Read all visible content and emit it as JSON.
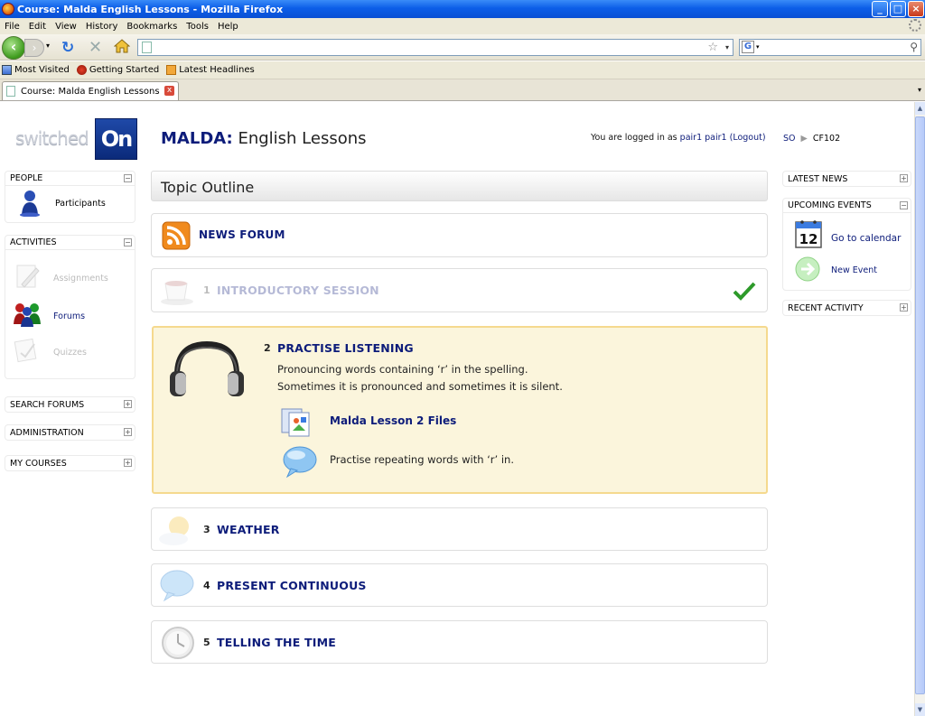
{
  "window": {
    "title": "Course: Malda English Lessons - Mozilla Firefox",
    "buttons": [
      "_",
      "□",
      "×"
    ]
  },
  "menu": [
    "File",
    "Edit",
    "View",
    "History",
    "Bookmarks",
    "Tools",
    "Help"
  ],
  "navbar": {
    "url": "",
    "search_value": ""
  },
  "bookmarks": [
    {
      "label": "Most Visited",
      "icon": "bookmark-folder-icon"
    },
    {
      "label": "Getting Started",
      "icon": "firefox-red-icon"
    },
    {
      "label": "Latest Headlines",
      "icon": "rss-feed-icon"
    }
  ],
  "tab": {
    "label": "Course: Malda English Lessons"
  },
  "header": {
    "logo_word": "switched",
    "logo_on": "On",
    "course_short": "MALDA:",
    "course_full": "English Lessons",
    "login_prefix": "You are logged in as",
    "user_name": "pair1 pair1",
    "logout": "(Logout)",
    "breadcrumb": [
      "SO",
      "CF102"
    ]
  },
  "left_blocks": {
    "people": {
      "title": "PEOPLE",
      "items": [
        {
          "label": "Participants",
          "icon": "person-icon"
        }
      ]
    },
    "activities": {
      "title": "ACTIVITIES",
      "items": [
        {
          "label": "Assignments",
          "icon": "pencil-icon"
        },
        {
          "label": "Forums",
          "icon": "group-icon"
        },
        {
          "label": "Quizzes",
          "icon": "quiz-icon"
        }
      ]
    },
    "search_forums": {
      "title": "SEARCH FORUMS"
    },
    "administration": {
      "title": "ADMINISTRATION"
    },
    "my_courses": {
      "title": "MY COURSES"
    }
  },
  "right_blocks": {
    "latest_news": {
      "title": "LATEST NEWS"
    },
    "upcoming_events": {
      "title": "UPCOMING EVENTS",
      "calendar_link": "Go to calendar",
      "calendar_day": "12",
      "new_event": "New Event"
    },
    "recent_activity": {
      "title": "RECENT ACTIVITY"
    }
  },
  "main": {
    "outline_title": "Topic Outline",
    "news_forum": "NEWS FORUM",
    "topics": [
      {
        "num": "1",
        "title": "INTRODUCTORY SESSION",
        "icon": "teacup-icon",
        "completed": true,
        "hidden": true
      },
      {
        "num": "2",
        "title": "PRACTISE LISTENING",
        "icon": "headphones-icon",
        "summary_line1": "Pronouncing words containing ‘r’ in the spelling.",
        "summary_line2": "Sometimes it is pronounced and sometimes it is silent.",
        "resources": [
          {
            "label": "Malda Lesson 2 Files",
            "icon": "files-icon",
            "link": true
          },
          {
            "label": "Practise repeating words with ‘r’ in.",
            "icon": "speech-bubble-icon",
            "link": false
          }
        ]
      },
      {
        "num": "3",
        "title": "WEATHER",
        "icon": "sun-cloud-icon"
      },
      {
        "num": "4",
        "title": "PRESENT CONTINUOUS",
        "icon": "speech-bubble-icon"
      },
      {
        "num": "5",
        "title": "TELLING THE TIME",
        "icon": "clock-icon"
      }
    ]
  },
  "colors": {
    "link": "#0d1c7a",
    "highlight_bg": "#fbf5dc",
    "highlight_border": "#f5d98e",
    "titlebar": "#0c5ee8"
  }
}
